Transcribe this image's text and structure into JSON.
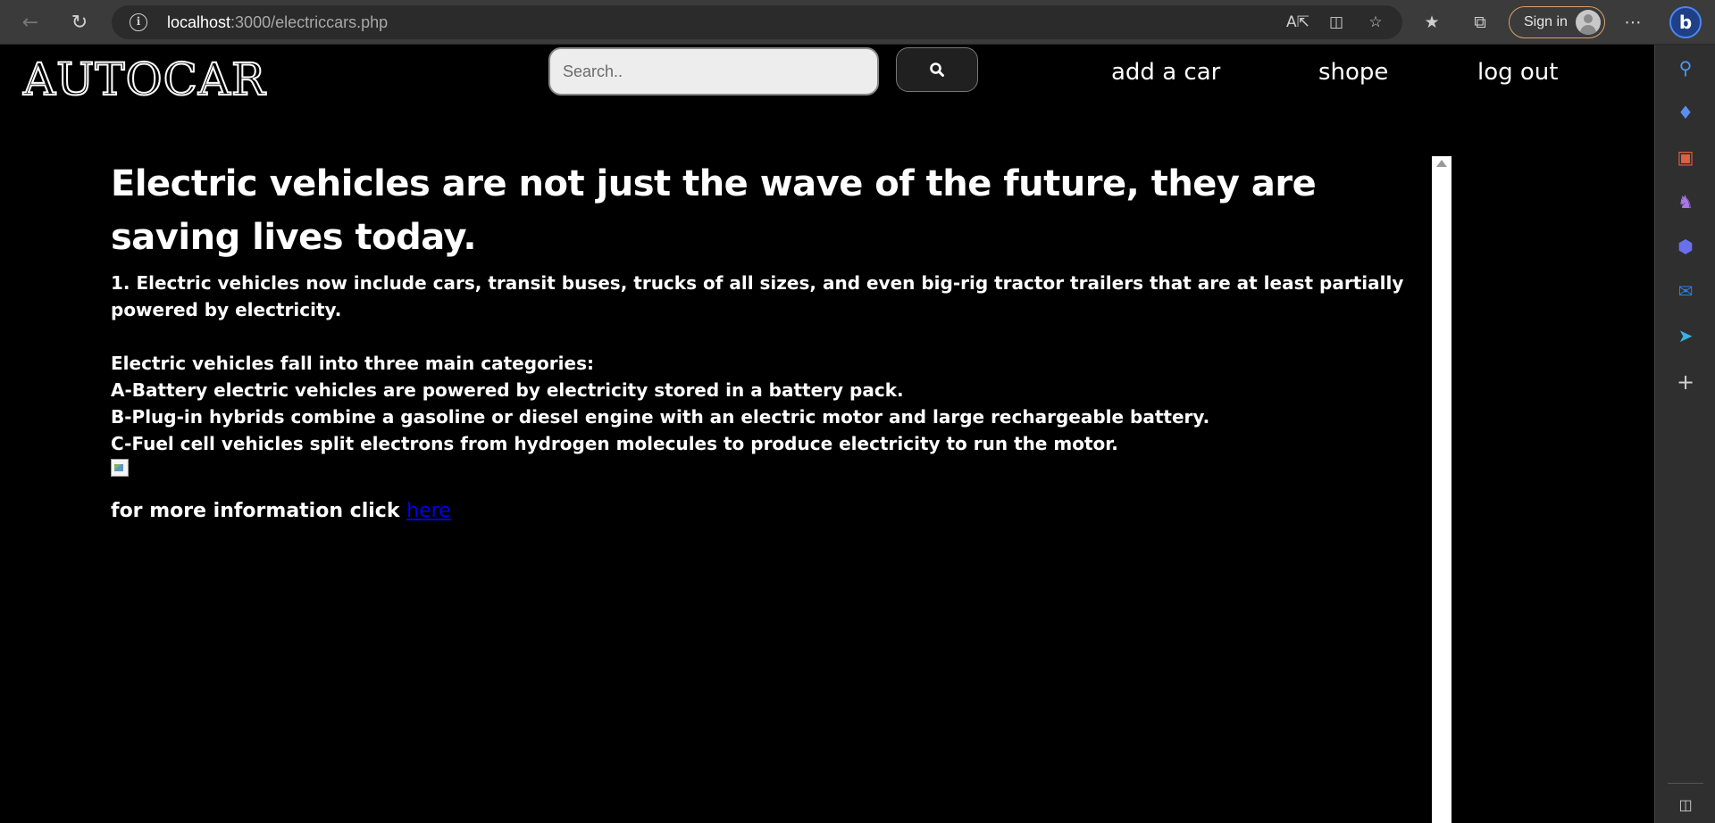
{
  "browser": {
    "url_host": "localhost",
    "url_rest": ":3000/electriccars.php",
    "signin_label": "Sign in",
    "bing_label": "b"
  },
  "site": {
    "logo": "AUTOCAR",
    "search": {
      "placeholder": "Search.."
    },
    "nav": [
      {
        "label": "add a car"
      },
      {
        "label": "shope"
      },
      {
        "label": "log out"
      }
    ]
  },
  "article": {
    "headline": "Electric vehicles are not just the wave of the future, they are saving lives today.",
    "intro": "1. Electric vehicles now include cars, transit buses, trucks of all sizes, and even big-rig tractor trailers that are at least partially powered by electricity.",
    "categories_heading": "Electric vehicles fall into three main categories:",
    "categories": [
      "A-Battery electric vehicles are powered by electricity stored in a battery pack.",
      "B-Plug-in hybrids combine a gasoline or diesel engine with an electric motor and large rechargeable battery.",
      "C-Fuel cell vehicles split electrons from hydrogen molecules to produce electricity to run the motor."
    ],
    "more_text": "for more information click ",
    "more_link": "here"
  },
  "colors": {
    "page_bg": "#000000",
    "link": "#0000ee",
    "signin_border": "#d9a16c",
    "browser_bar": "#3b3b3b"
  }
}
